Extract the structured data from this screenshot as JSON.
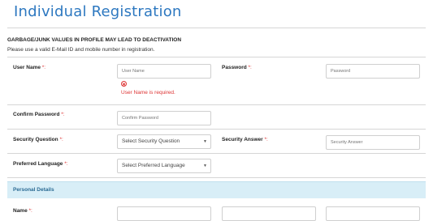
{
  "page": {
    "title": "Individual Registration"
  },
  "notice": {
    "warning": "GARBAGE/JUNK VALUES IN PROFILE MAY LEAD TO DEACTIVATION",
    "info": "Please use a valid E-Mail ID and mobile number in registration."
  },
  "required_marker": "*:",
  "fields": {
    "username": {
      "label": "User Name",
      "placeholder": "User Name",
      "error": "User Name is required."
    },
    "password": {
      "label": "Password",
      "placeholder": "Password"
    },
    "confirm_password": {
      "label": "Confirm Password",
      "placeholder": "Confirm Password"
    },
    "security_question": {
      "label": "Security Question",
      "selected": "Select Security Question"
    },
    "security_answer": {
      "label": "Security Answer",
      "placeholder": "Security Answer"
    },
    "preferred_language": {
      "label": "Preferred Language",
      "selected": "Select Preferred Language"
    },
    "name": {
      "label": "Name"
    }
  },
  "sections": {
    "personal_details": "Personal Details"
  },
  "icons": {
    "error": "error-circle-x-icon",
    "dropdown": "chevron-down-icon"
  },
  "colors": {
    "title": "#2d78c0",
    "error": "#dd3333",
    "section_bg": "#d8eef7"
  }
}
